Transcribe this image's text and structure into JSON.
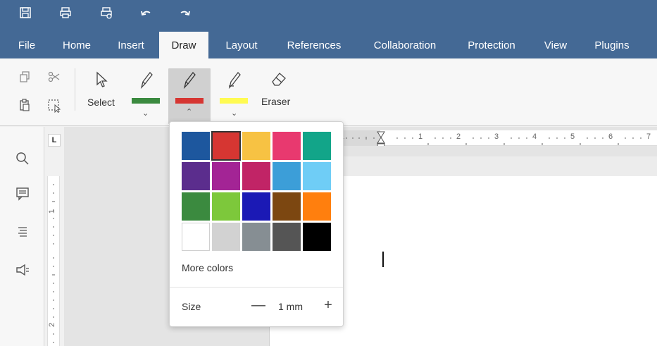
{
  "quick_access": [
    {
      "name": "save-icon",
      "glyph": "🖫"
    },
    {
      "name": "print-icon",
      "glyph": "⎙"
    },
    {
      "name": "quick-print-icon",
      "glyph": "⎙"
    },
    {
      "name": "undo-icon",
      "glyph": "↶"
    },
    {
      "name": "redo-icon",
      "glyph": "↷"
    }
  ],
  "tabs": [
    "File",
    "Home",
    "Insert",
    "Draw",
    "Layout",
    "References",
    "Collaboration",
    "Protection",
    "View",
    "Plugins"
  ],
  "active_tab": "Draw",
  "toolbar": {
    "select_label": "Select",
    "eraser_label": "Eraser",
    "pen1_color": "#3b8a3f",
    "pen2_color": "#d63632",
    "highlighter_color": "#fffb52"
  },
  "ruler_numbers": [
    "1",
    "1",
    "2",
    "3",
    "4",
    "5",
    "6",
    "7"
  ],
  "vruler_numbers": [
    "1",
    "2"
  ],
  "popup": {
    "colors": [
      [
        "#1d579e",
        "#d63632",
        "#f7c243",
        "#e8396f",
        "#12a589"
      ],
      [
        "#5b2d8d",
        "#a32495",
        "#c12466",
        "#3c9ed8",
        "#6fcdf6"
      ],
      [
        "#3b8a3f",
        "#7dc83b",
        "#1b19b5",
        "#7c4711",
        "#ff7f0e"
      ],
      [
        "#ffffff",
        "#d2d2d2",
        "#868e93",
        "#555555",
        "#000000"
      ]
    ],
    "selected": "#d63632",
    "more_colors": "More colors",
    "size_label": "Size",
    "size_value": "1 mm",
    "minus": "—",
    "plus": "+"
  }
}
